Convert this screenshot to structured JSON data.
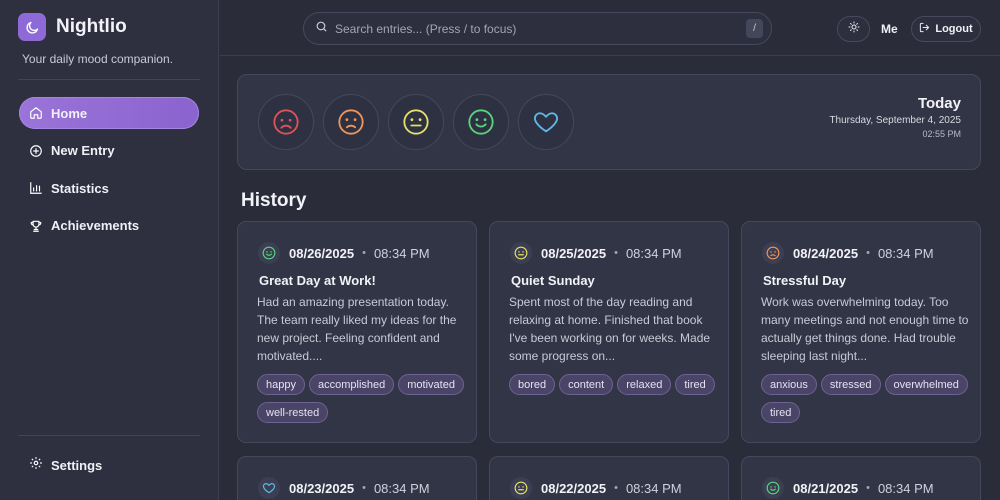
{
  "app": {
    "name": "Nightlio",
    "tagline": "Your daily mood companion."
  },
  "nav": {
    "items": [
      {
        "label": "Home",
        "icon": "home-icon",
        "active": true
      },
      {
        "label": "New Entry",
        "icon": "plus-circle-icon",
        "active": false
      },
      {
        "label": "Statistics",
        "icon": "bar-chart-icon",
        "active": false
      },
      {
        "label": "Achievements",
        "icon": "trophy-icon",
        "active": false
      }
    ],
    "settings_label": "Settings"
  },
  "topbar": {
    "search_placeholder": "Search entries... (Press / to focus)",
    "search_shortcut": "/",
    "user_label": "Me",
    "logout_label": "Logout"
  },
  "mood_picker": {
    "moods": [
      "terrible",
      "bad",
      "okay",
      "good",
      "amazing"
    ],
    "colors": {
      "terrible": "#e0525a",
      "bad": "#f0955a",
      "okay": "#e5e06a",
      "good": "#59d47d",
      "amazing": "#5fb9e8"
    }
  },
  "today": {
    "title": "Today",
    "date": "Thursday, September 4, 2025",
    "time": "02:55 PM"
  },
  "history": {
    "title": "History",
    "entries": [
      {
        "mood": "good",
        "date": "08/26/2025",
        "time": "08:34 PM",
        "title": "Great Day at Work!",
        "excerpt": "Had an amazing presentation today. The team really liked my ideas for the new project. Feeling confident and motivated....",
        "tags": [
          "happy",
          "accomplished",
          "motivated",
          "well-rested"
        ]
      },
      {
        "mood": "okay",
        "date": "08/25/2025",
        "time": "08:34 PM",
        "title": "Quiet Sunday",
        "excerpt": "Spent most of the day reading and relaxing at home. Finished that book I've been working on for weeks. Made some progress on...",
        "tags": [
          "bored",
          "content",
          "relaxed",
          "tired"
        ]
      },
      {
        "mood": "bad",
        "date": "08/24/2025",
        "time": "08:34 PM",
        "title": "Stressful Day",
        "excerpt": "Work was overwhelming today. Too many meetings and not enough time to actually get things done. Had trouble sleeping last night...",
        "tags": [
          "anxious",
          "stressed",
          "overwhelmed",
          "tired"
        ]
      },
      {
        "mood": "amazing",
        "date": "08/23/2025",
        "time": "08:34 PM"
      },
      {
        "mood": "okay",
        "date": "08/22/2025",
        "time": "08:34 PM"
      },
      {
        "mood": "good",
        "date": "08/21/2025",
        "time": "08:34 PM"
      }
    ]
  }
}
